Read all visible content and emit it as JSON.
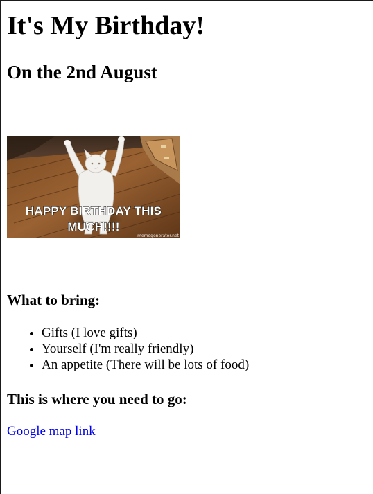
{
  "page": {
    "title": "It's My Birthday!",
    "date_heading": "On the 2nd August"
  },
  "meme": {
    "caption_line1": "HAPPY BIRTHDAY THIS",
    "caption_line2": "MUCH!!!!",
    "watermark": "memegenerator.net",
    "subject": "white cat standing on hind legs with arms raised on wooden floor"
  },
  "bring": {
    "heading": "What to bring:",
    "items": [
      "Gifts (I love gifts)",
      "Yourself (I'm really friendly)",
      "An appetite (There will be lots of food)"
    ]
  },
  "directions": {
    "heading": "This is where you need to go:",
    "link_label": "Google map link"
  },
  "colors": {
    "link": "#0000ee",
    "text": "#000000",
    "background": "#ffffff"
  }
}
